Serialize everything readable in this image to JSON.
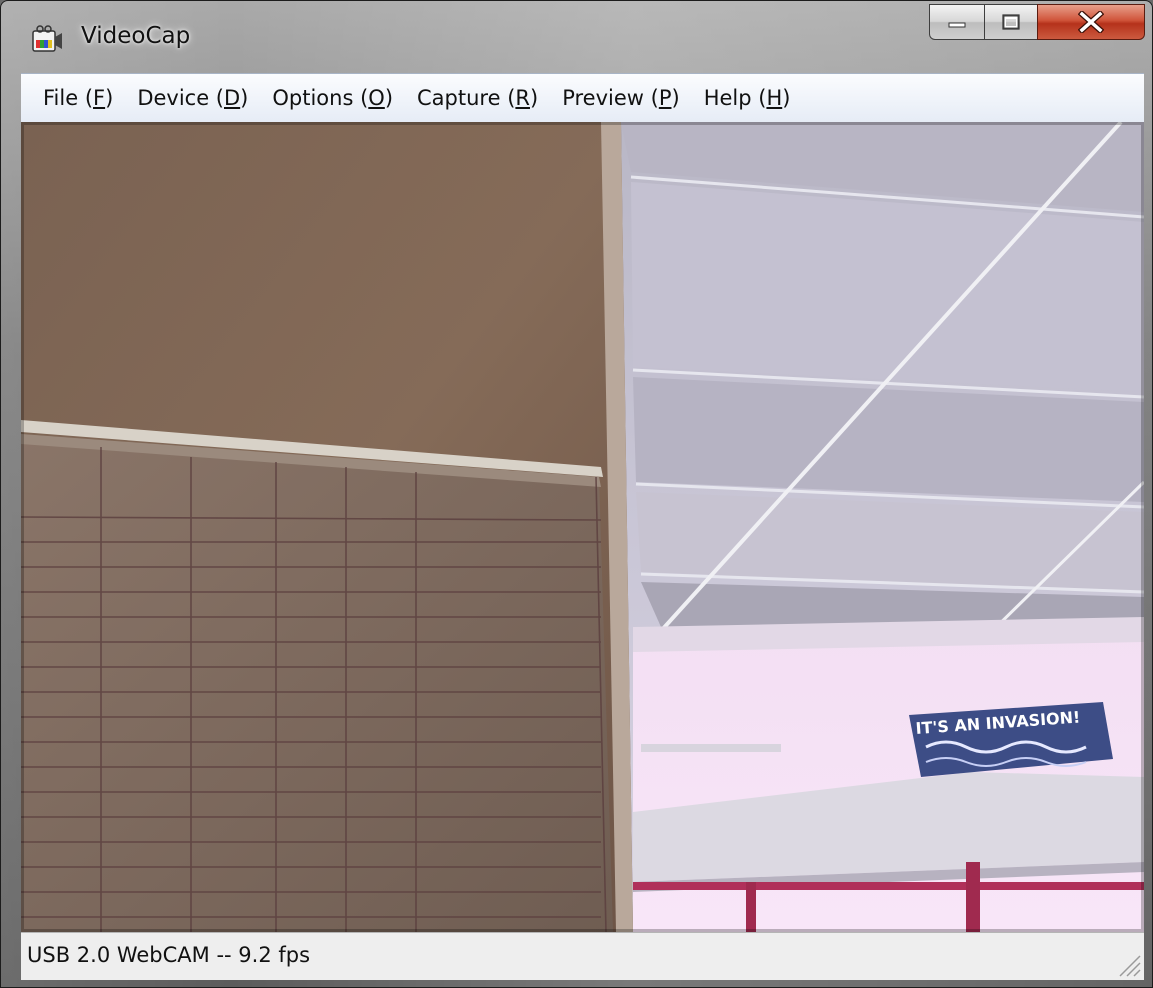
{
  "window": {
    "title": "VideoCap",
    "icon": "camera-app-icon",
    "controls": [
      "minimize-icon",
      "maximize-icon",
      "close-icon"
    ]
  },
  "menu": {
    "items": [
      {
        "label": "File (",
        "key": "F",
        "suffix": ")"
      },
      {
        "label": "Device (",
        "key": "D",
        "suffix": ")"
      },
      {
        "label": "Options (",
        "key": "O",
        "suffix": ")"
      },
      {
        "label": "Capture (",
        "key": "R",
        "suffix": ")"
      },
      {
        "label": "Preview (",
        "key": "P",
        "suffix": ")"
      },
      {
        "label": "Help (",
        "key": "H",
        "suffix": ")"
      }
    ]
  },
  "preview": {
    "sign_text": "IT'S AN INVASION!"
  },
  "status": {
    "text": "USB 2.0 WebCAM -- 9.2 fps"
  },
  "colors": {
    "menubar": "#eef2f9",
    "close_button": "#c9432a",
    "statusbar": "#eeeeee"
  }
}
